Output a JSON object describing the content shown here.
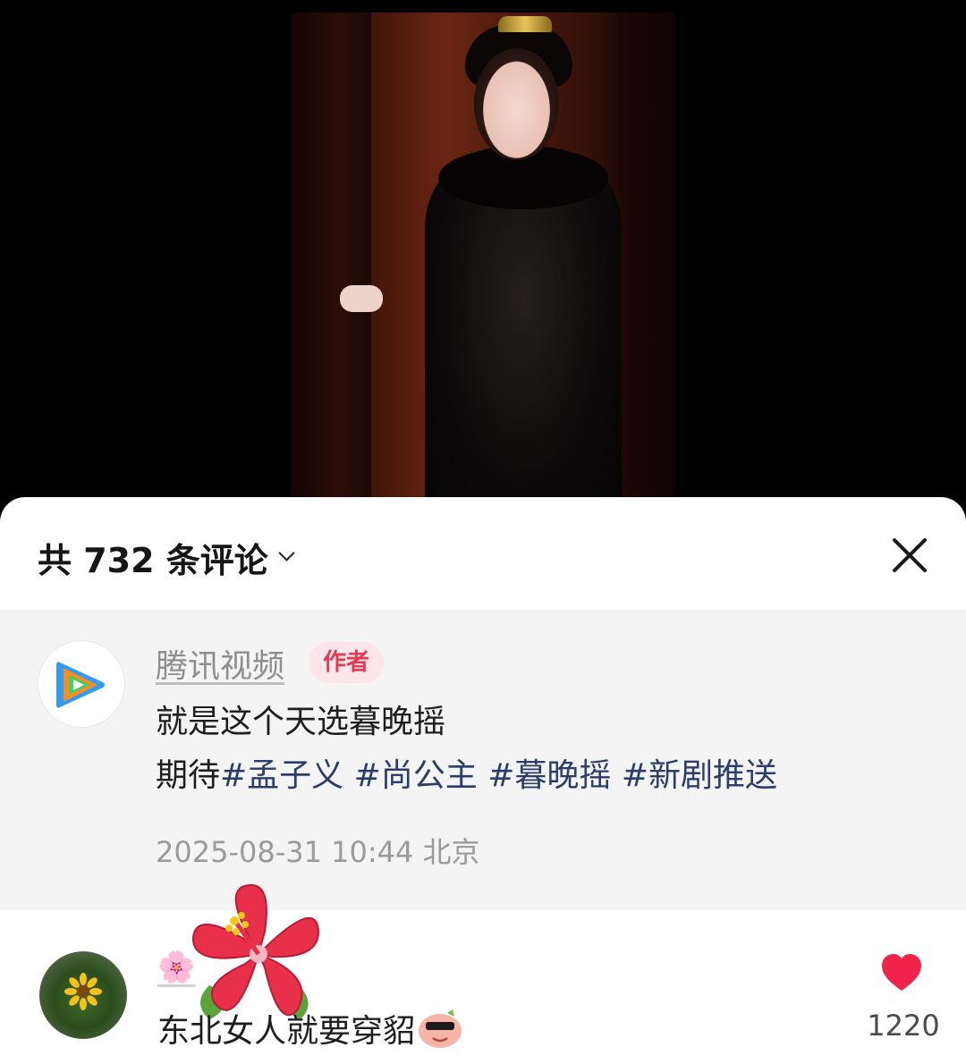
{
  "comments_panel": {
    "title": "共 732 条评论",
    "close_icon": "close-icon",
    "chevron_icon": "chevron-down-icon"
  },
  "pinned_comment": {
    "author": "腾讯视频",
    "badge": "作者",
    "text_line1": "就是这个天选暮晚摇",
    "text_line2_prefix": "期待",
    "hashtags": [
      "#孟子义",
      "#尚公主",
      "#暮晚摇",
      "#新剧推送"
    ],
    "timestamp": "2025-08-31 10:44",
    "location": "北京"
  },
  "comment2": {
    "author": "🌸",
    "text": "东北女人就要穿貂",
    "like_count": "1220"
  },
  "colors": {
    "badge_bg": "#fde6ea",
    "badge_text": "#e33a54",
    "hashtag": "#2b3d6a",
    "like_heart": "#f0244a"
  }
}
